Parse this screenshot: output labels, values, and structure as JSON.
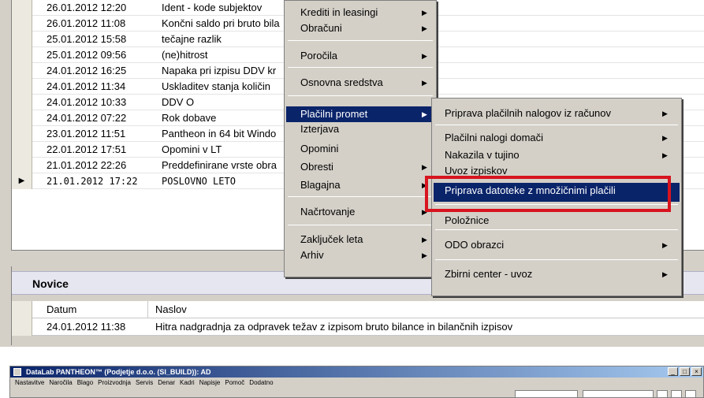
{
  "list": {
    "rows": [
      {
        "date": "26.01.2012 12:20",
        "title": "Ident - kode subjektov",
        "selected": false
      },
      {
        "date": "26.01.2012 11:08",
        "title": "Končni saldo pri bruto bila",
        "selected": false
      },
      {
        "date": "25.01.2012 15:58",
        "title": "tečajne razlik",
        "selected": false
      },
      {
        "date": "25.01.2012 09:56",
        "title": "(ne)hitrost",
        "selected": false
      },
      {
        "date": "24.01.2012 16:25",
        "title": "Napaka pri izpisu DDV kr",
        "selected": false
      },
      {
        "date": "24.01.2012 11:34",
        "title": "Uskladitev stanja količin",
        "selected": false
      },
      {
        "date": "24.01.2012 10:33",
        "title": "DDV O",
        "selected": false
      },
      {
        "date": "24.01.2012 07:22",
        "title": "Rok dobave",
        "selected": false
      },
      {
        "date": "23.01.2012 11:51",
        "title": "Pantheon in 64 bit Windo",
        "selected": false
      },
      {
        "date": "22.01.2012 17:51",
        "title": "Opomini v LT",
        "selected": false
      },
      {
        "date": "21.01.2012 22:26",
        "title": "Preddefinirane vrste obra",
        "selected": false
      },
      {
        "date": "21.01.2012 17:22",
        "title": "POSLOVNO LETO",
        "selected": true
      }
    ]
  },
  "main_menu": {
    "items": [
      {
        "label": "Krediti in leasingi",
        "submenu": true
      },
      {
        "label": "Obračuni",
        "submenu": true
      },
      {
        "label": "Poročila",
        "submenu": true
      },
      {
        "label": "Osnovna sredstva",
        "submenu": true
      },
      {
        "label": "Plačilni promet",
        "submenu": true,
        "active": true
      },
      {
        "label": "Izterjava",
        "submenu": false
      },
      {
        "label": "Opomini",
        "submenu": false
      },
      {
        "label": "Obresti",
        "submenu": true
      },
      {
        "label": "Blagajna",
        "submenu": true
      },
      {
        "label": "Načrtovanje",
        "submenu": true
      },
      {
        "label": "Zaključek leta",
        "submenu": true
      },
      {
        "label": "Arhiv",
        "submenu": true
      }
    ]
  },
  "sub_menu": {
    "items": [
      {
        "label": "Priprava plačilnih nalogov iz računov",
        "submenu": true
      },
      {
        "label": "Plačilni nalogi domači",
        "submenu": true
      },
      {
        "label": "Nakazila v tujino",
        "submenu": true
      },
      {
        "label": "Uvoz izpiskov",
        "submenu": false
      },
      {
        "label": "Priprava datoteke z množičnimi plačili",
        "submenu": false,
        "highlighted": true
      },
      {
        "label": "Položnice",
        "submenu": false
      },
      {
        "label": "ODO obrazci",
        "submenu": true
      },
      {
        "label": "Zbirni center - uvoz",
        "submenu": true
      }
    ],
    "highlight_color": "#d8141e"
  },
  "novice": {
    "title": "Novice",
    "col_date": "Datum",
    "col_title": "Naslov",
    "row_date": "24.01.2012 11:38",
    "row_title": "Hitra nadgradnja za odpravek težav z izpisom bruto bilance in bilančnih izpisov"
  },
  "window2": {
    "title": "DataLab PANTHEON™ (Podjetje d.o.o. (SI_BUILD)): AD",
    "menu": [
      "Nastavitve",
      "Naročila",
      "Blago",
      "Proizvodnja",
      "Servis",
      "Denar",
      "Kadri",
      "Napisje",
      "Pomoč",
      "Dodatno"
    ],
    "btn_min": "_",
    "btn_max": "□",
    "btn_close": "×"
  },
  "icons": {
    "arrow": "▶",
    "row_pointer": "▶"
  }
}
